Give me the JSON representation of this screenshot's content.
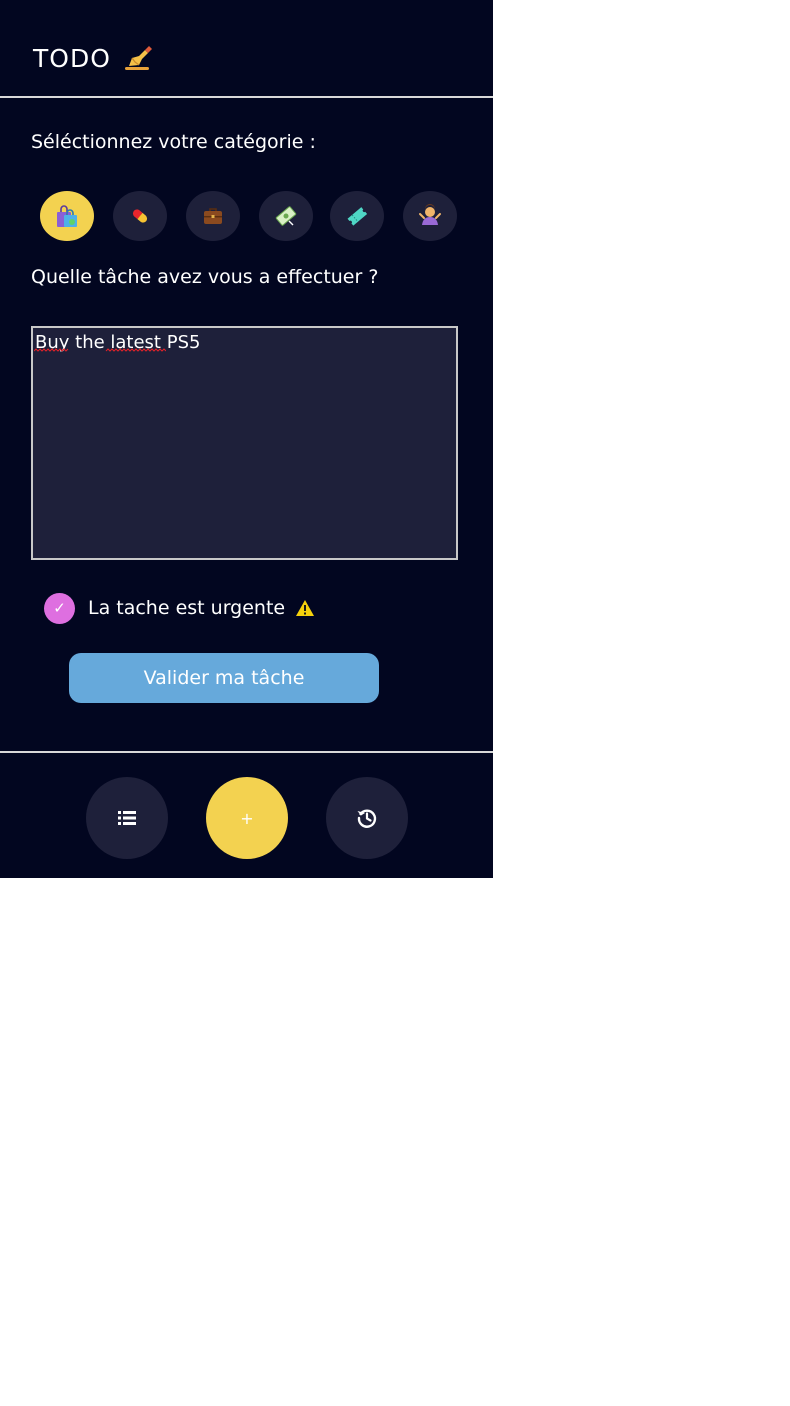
{
  "header": {
    "title": "TODO",
    "title_icon": "writing-hand-icon"
  },
  "category_section": {
    "label": "Séléctionnez votre catégorie :",
    "items": [
      {
        "icon": "shopping-bags-icon",
        "selected": true
      },
      {
        "icon": "pill-icon",
        "selected": false
      },
      {
        "icon": "briefcase-icon",
        "selected": false
      },
      {
        "icon": "money-bill-icon",
        "selected": false
      },
      {
        "icon": "ticket-icon",
        "selected": false
      },
      {
        "icon": "person-shrugging-icon",
        "selected": false
      }
    ]
  },
  "task_section": {
    "label": "Quelle tâche avez vous a effectuer ?",
    "value": "Buy the latest PS5"
  },
  "urgent": {
    "checked": true,
    "checkmark": "✓",
    "label": "La tache est urgente",
    "icon": "warning-icon"
  },
  "submit": {
    "label": "Valider ma tâche"
  },
  "bottom_nav": {
    "items": [
      {
        "icon": "list-icon",
        "active": false
      },
      {
        "icon": "plus-icon",
        "label": "+",
        "active": true
      },
      {
        "icon": "history-icon",
        "active": false
      }
    ]
  },
  "colors": {
    "background": "#020620",
    "surface": "#1e203a",
    "accent_yellow": "#f3d250",
    "accent_pink": "#de6fe0",
    "button_blue": "#66a9db"
  }
}
